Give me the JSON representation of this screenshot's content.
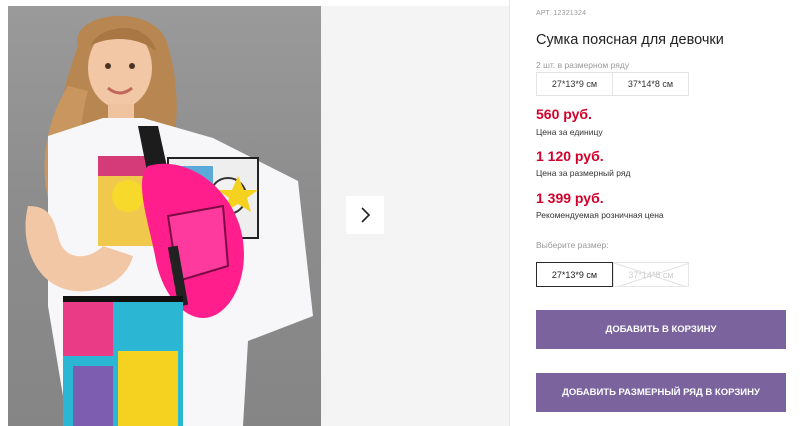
{
  "product": {
    "article": "АРТ. 12321324",
    "title": "Сумка поясная для девочки",
    "pack_note": "2 шт. в размерном ряду",
    "pack_sizes": [
      "27*13*9 см",
      "37*14*8 см"
    ]
  },
  "prices": {
    "unit_price": "560 руб.",
    "unit_label": "Цена за единицу",
    "pack_price": "1 120 руб.",
    "pack_label": "Цена за размерный ряд",
    "retail_price": "1 399 руб.",
    "retail_label": "Рекомендуемая розничная цена"
  },
  "size_select": {
    "label": "Выберите размер:",
    "options": [
      {
        "label": "27*13*9 см",
        "state": "selected"
      },
      {
        "label": "37*14*8 см",
        "state": "unavailable"
      }
    ]
  },
  "buttons": {
    "add_to_cart": "ДОБАВИТЬ В КОРЗИНУ",
    "add_pack_to_cart": "ДОБАВИТЬ РАЗМЕРНЫЙ РЯД В КОРЗИНУ"
  },
  "colors": {
    "price": "#d4002a",
    "button": "#7b649d"
  },
  "icons": {
    "gallery_next": "chevron-right-icon"
  }
}
